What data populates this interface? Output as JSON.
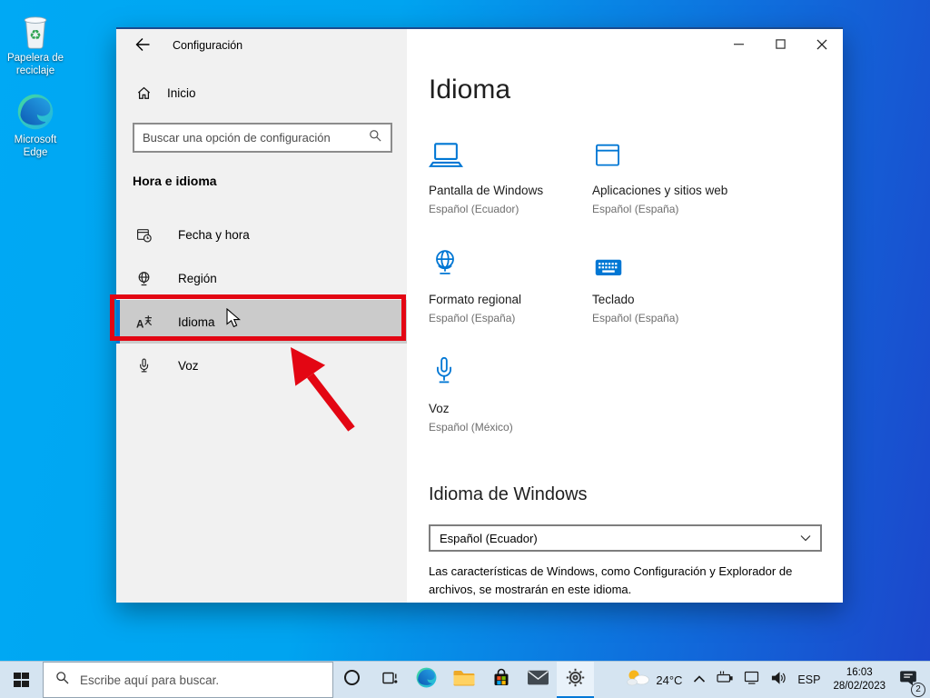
{
  "desktop": {
    "icons": [
      {
        "label": "Papelera de reciclaje",
        "icon": "recycle-bin-icon"
      },
      {
        "label": "Microsoft Edge",
        "icon": "edge-icon"
      }
    ]
  },
  "settings_window": {
    "titlebar": {
      "title": "Configuración",
      "controls": [
        "minimize",
        "maximize",
        "close"
      ]
    },
    "sidebar": {
      "home_label": "Inicio",
      "search_placeholder": "Buscar una opción de configuración",
      "section_heading": "Hora e idioma",
      "items": [
        {
          "label": "Fecha y hora",
          "icon": "calendar-clock-icon",
          "selected": false
        },
        {
          "label": "Región",
          "icon": "desk-globe-icon",
          "selected": false
        },
        {
          "label": "Idioma",
          "icon": "language-icon",
          "selected": true
        },
        {
          "label": "Voz",
          "icon": "microphone-icon",
          "selected": false
        }
      ]
    },
    "main": {
      "page_title": "Idioma",
      "tiles": [
        {
          "label": "Pantalla de Windows",
          "value": "Español (Ecuador)",
          "icon": "laptop-icon"
        },
        {
          "label": "Aplicaciones y sitios web",
          "value": "Español (España)",
          "icon": "browser-window-icon"
        },
        {
          "label": "Formato regional",
          "value": "Español (España)",
          "icon": "desk-globe-icon"
        },
        {
          "label": "Teclado",
          "value": "Español (España)",
          "icon": "keyboard-icon"
        },
        {
          "label": "Voz",
          "value": "Español (México)",
          "icon": "microphone-icon"
        }
      ],
      "windows_language": {
        "heading": "Idioma de Windows",
        "selected_value": "Español (Ecuador)",
        "description": "Las características de Windows, como Configuración y Explorador de archivos, se mostrarán en este idioma."
      }
    }
  },
  "annotations": {
    "highlighted_item": "Idioma"
  },
  "taskbar": {
    "search_placeholder": "Escribe aquí para buscar.",
    "app_icons": [
      "cortana-icon",
      "task-view-icon",
      "edge-icon",
      "file-explorer-icon",
      "store-icon",
      "mail-icon",
      "settings-icon"
    ],
    "active_app": "settings",
    "tray": {
      "temperature": "24°C",
      "input_language": "ESP",
      "time": "16:03",
      "date": "28/02/2023",
      "notification_count": "2"
    }
  },
  "colors": {
    "accent": "#0078d7",
    "annotation_red": "#e30613",
    "desktop_gradient_start": "#00a9f4",
    "desktop_gradient_end": "#1c46cb",
    "sidebar_bg": "#f1f1f1",
    "selected_item_bg": "#cbcbcb",
    "taskbar_bg": "#d5e4f1",
    "tile_icon_blue": "#0077d4"
  }
}
